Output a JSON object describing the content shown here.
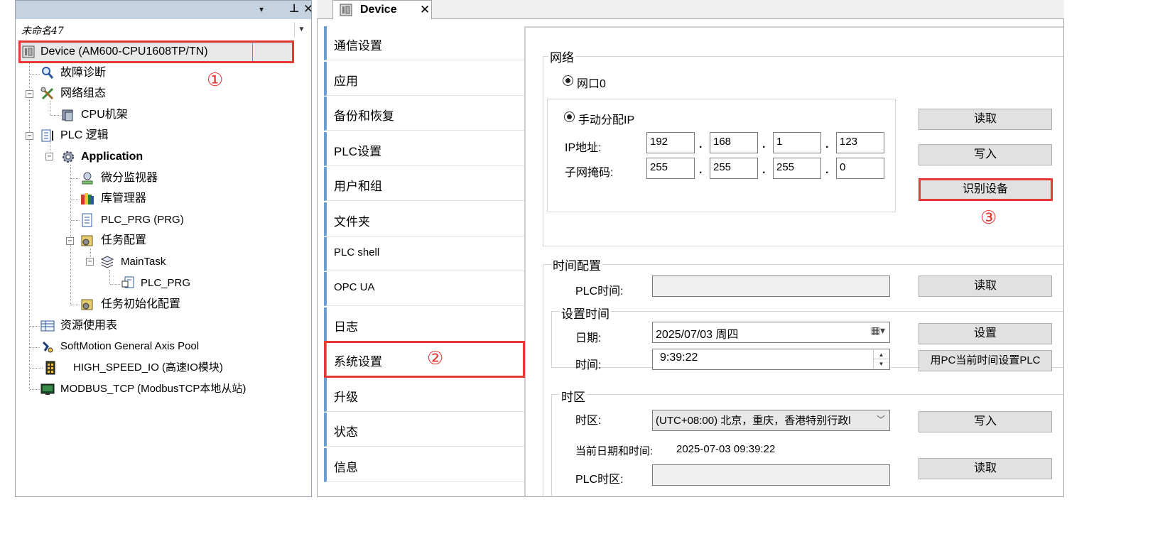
{
  "project_tree": {
    "project_name": "未命名47",
    "header_buttons": {
      "dropdown": "▾",
      "pin": "⊥",
      "close": "✕"
    },
    "combo_arrow": "▼",
    "items": [
      {
        "label": "Device (AM600-CPU1608TP/TN)",
        "icon": "device-icon"
      },
      {
        "label": "故障诊断",
        "icon": "magnifier-icon"
      },
      {
        "label": "网络组态",
        "icon": "network-tools-icon"
      },
      {
        "label": "CPU机架",
        "icon": "cpu-rack-icon"
      },
      {
        "label": "PLC 逻辑",
        "icon": "plc-logic-icon"
      },
      {
        "label": "Application",
        "icon": "application-gear-icon"
      },
      {
        "label": "微分监视器",
        "icon": "trace-monitor-icon"
      },
      {
        "label": "库管理器",
        "icon": "library-books-icon"
      },
      {
        "label": "PLC_PRG (PRG)",
        "icon": "program-page-icon"
      },
      {
        "label": "任务配置",
        "icon": "task-config-icon"
      },
      {
        "label": "MainTask",
        "icon": "main-task-icon"
      },
      {
        "label": "PLC_PRG",
        "icon": "program-call-icon"
      },
      {
        "label": "任务初始化配置",
        "icon": "task-init-icon"
      },
      {
        "label": "资源使用表",
        "icon": "resource-table-icon"
      },
      {
        "label": "SoftMotion General Axis Pool",
        "icon": "axis-pool-icon"
      },
      {
        "label": "HIGH_SPEED_IO (高速IO模块)",
        "icon": "io-module-icon"
      },
      {
        "label": "MODBUS_TCP (ModbusTCP本地从站)",
        "icon": "modbus-slave-icon"
      }
    ]
  },
  "editor": {
    "tab": {
      "title": "Device",
      "close": "✕"
    },
    "nav_items": [
      "通信设置",
      "应用",
      "备份和恢复",
      "PLC设置",
      "用户和组",
      "文件夹",
      "PLC shell",
      "OPC UA",
      "日志",
      "系统设置",
      "升级",
      "状态",
      "信息"
    ],
    "network": {
      "title": "网络",
      "port_label": "网口0",
      "manual_ip_label": "手动分配IP",
      "ip_label": "IP地址:",
      "mask_label": "子网掩码:",
      "ip": [
        "192",
        "168",
        "1",
        "123"
      ],
      "mask": [
        "255",
        "255",
        "255",
        "0"
      ],
      "dot": ".",
      "read_button": "读取",
      "write_button": "写入",
      "identify_button": "识别设备"
    },
    "time_config": {
      "title": "时间配置",
      "plc_time_label": "PLC时间:",
      "plc_time_value": "",
      "read_button": "读取",
      "set_time_title": "设置时间",
      "date_label": "日期:",
      "date_value": "2025/07/03 周四",
      "time_label": "时间:",
      "time_value": "9:39:22",
      "set_button": "设置",
      "set_from_pc_button": "用PC当前时间设置PLC"
    },
    "timezone": {
      "title": "时区",
      "zone_label": "时区:",
      "zone_value": "(UTC+08:00) 北京，重庆，香港特别行政l",
      "write_button": "写入",
      "current_label": "当前日期和时间:",
      "current_value": "2025-07-03 09:39:22",
      "plc_zone_label": "PLC时区:",
      "plc_zone_value": "",
      "read_button": "读取"
    }
  },
  "annotations": {
    "step1": "①",
    "step2": "②",
    "step3": "③",
    "color": "#e53935"
  }
}
